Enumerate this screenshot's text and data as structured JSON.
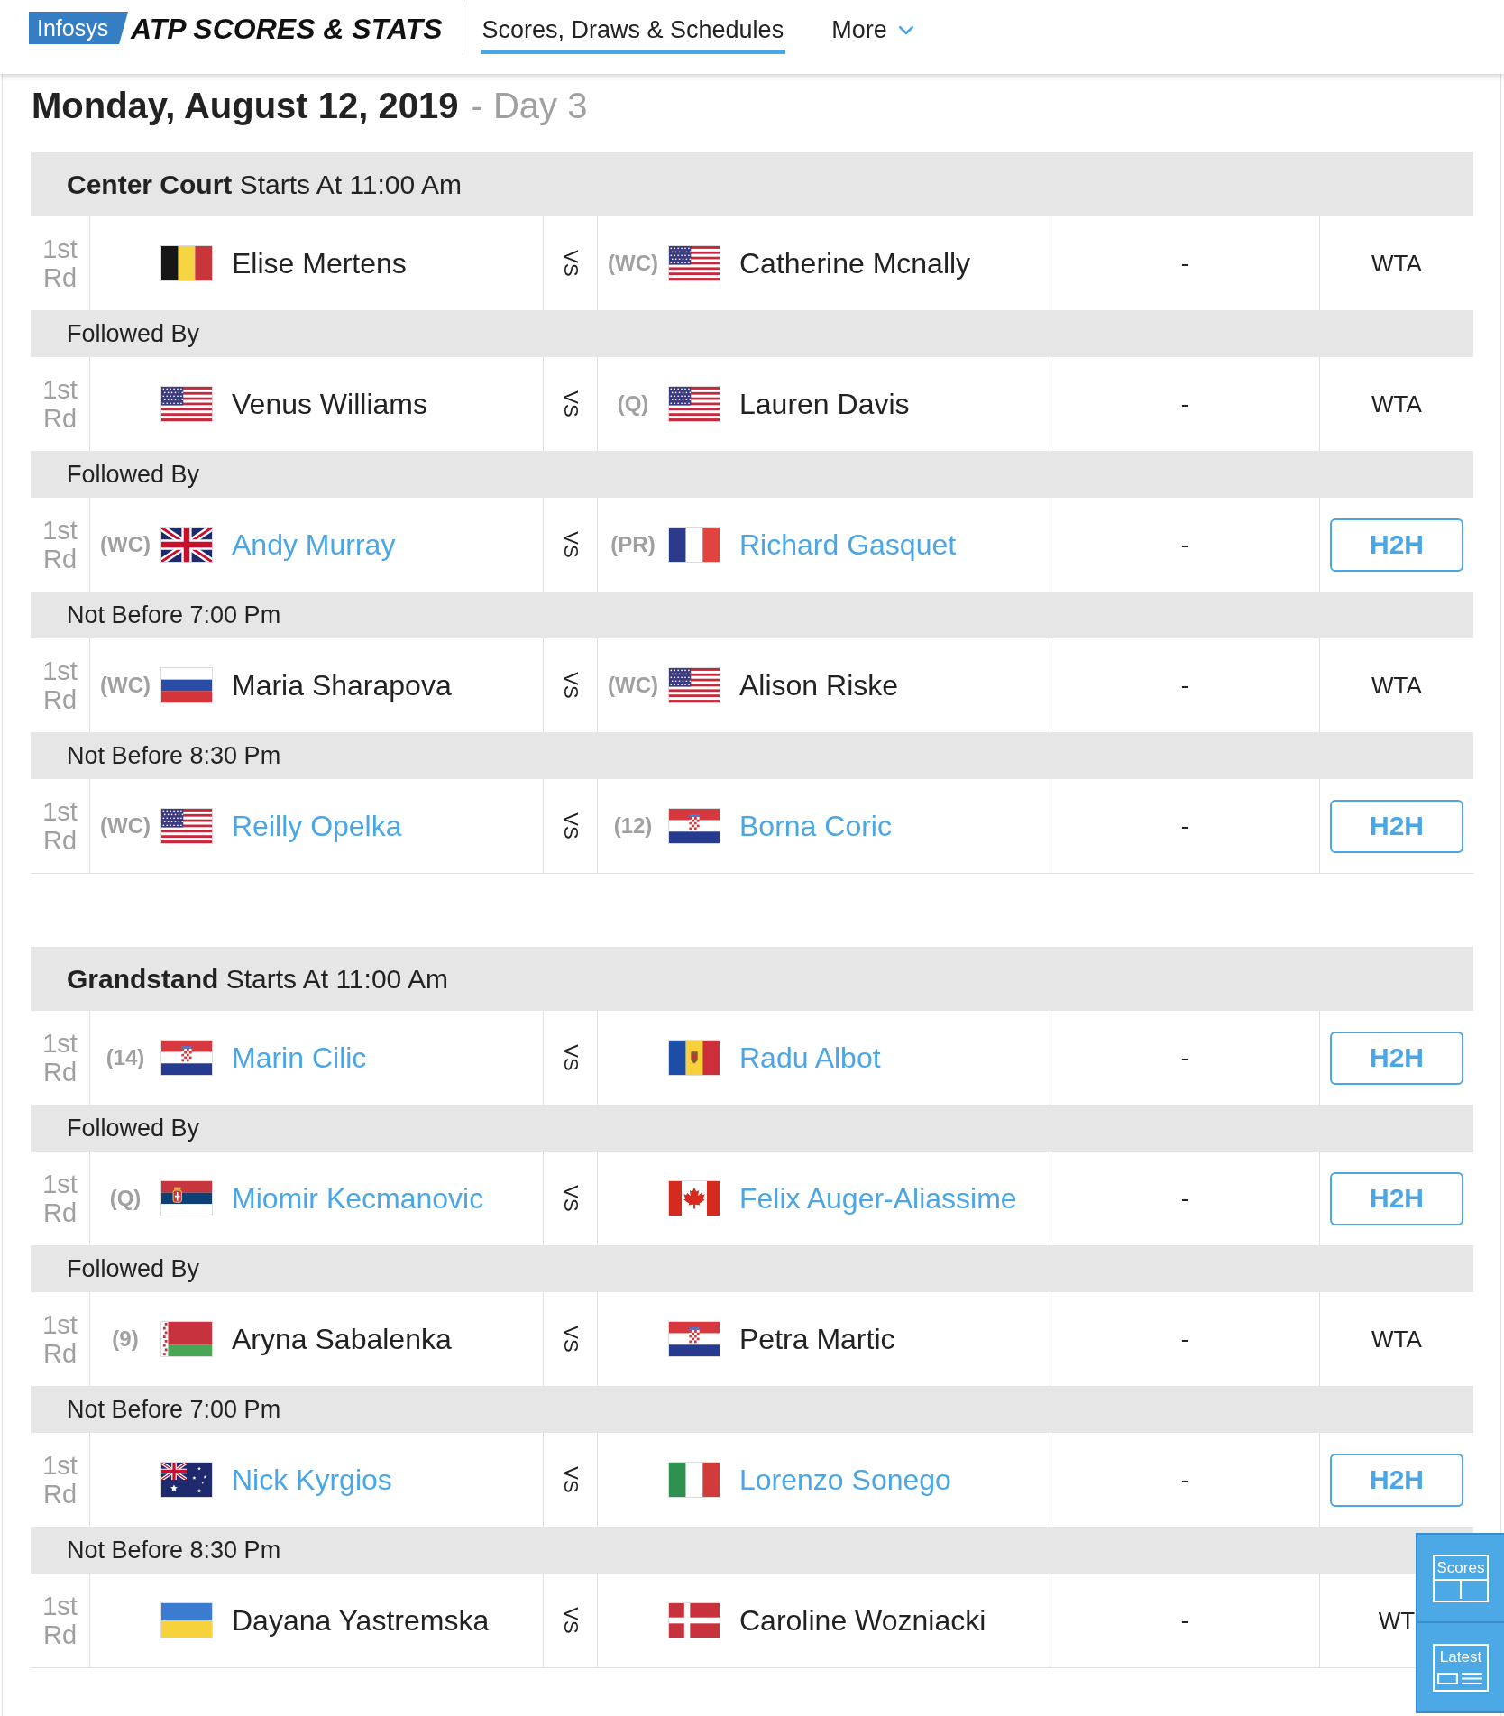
{
  "header": {
    "sponsor": "Infosys",
    "brand": "ATP SCORES & STATS",
    "tabs": [
      {
        "label": "Scores, Draws & Schedules",
        "selected": true,
        "menu": false
      },
      {
        "label": "More",
        "selected": false,
        "menu": true
      }
    ]
  },
  "date": "Monday, August 12, 2019",
  "day": "- Day 3",
  "courts": [
    {
      "title": "**Center Court** Starts At 11:00 Am",
      "rows": [
        {
          "kind": "match",
          "round": "1st Rd",
          "player1": {
            "flag": {
              "kind": "belgium"
            },
            "name": "Elise Mertens",
            "link": false
          },
          "vs": "VS",
          "player2": {
            "seed": "(WC)",
            "flag": {
              "kind": "usa"
            },
            "name": "Catherine Mcnally",
            "link": false
          },
          "score": "-",
          "action": {
            "kind": "tag",
            "label": "WTA"
          }
        },
        {
          "kind": "note",
          "text": "Followed By"
        },
        {
          "kind": "match",
          "round": "1st Rd",
          "player1": {
            "flag": {
              "kind": "usa"
            },
            "name": "Venus Williams",
            "link": false
          },
          "vs": "VS",
          "player2": {
            "seed": "(Q)",
            "flag": {
              "kind": "usa"
            },
            "name": "Lauren Davis",
            "link": false
          },
          "score": "-",
          "action": {
            "kind": "tag",
            "label": "WTA"
          }
        },
        {
          "kind": "note",
          "text": "Followed By"
        },
        {
          "kind": "match",
          "round": "1st Rd",
          "player1": {
            "seed": "(WC)",
            "flag": {
              "kind": "uk"
            },
            "name": "Andy Murray",
            "link": true
          },
          "vs": "VS",
          "player2": {
            "seed": "(PR)",
            "flag": {
              "kind": "france"
            },
            "name": "Richard Gasquet",
            "link": true
          },
          "score": "-",
          "action": {
            "kind": "button",
            "label": "H2H"
          }
        },
        {
          "kind": "note",
          "text": "Not Before 7:00 Pm"
        },
        {
          "kind": "match",
          "round": "1st Rd",
          "player1": {
            "seed": "(WC)",
            "flag": {
              "kind": "russia"
            },
            "name": "Maria Sharapova",
            "link": false
          },
          "vs": "VS",
          "player2": {
            "seed": "(WC)",
            "flag": {
              "kind": "usa"
            },
            "name": "Alison Riske",
            "link": false
          },
          "score": "-",
          "action": {
            "kind": "tag",
            "label": "WTA"
          }
        },
        {
          "kind": "note",
          "text": "Not Before 8:30 Pm"
        },
        {
          "kind": "match",
          "round": "1st Rd",
          "player1": {
            "seed": "(WC)",
            "flag": {
              "kind": "usa"
            },
            "name": "Reilly Opelka",
            "link": true
          },
          "vs": "VS",
          "player2": {
            "seed": "(12)",
            "flag": {
              "kind": "croatia"
            },
            "name": "Borna Coric",
            "link": true
          },
          "score": "-",
          "action": {
            "kind": "button",
            "label": "H2H"
          }
        }
      ]
    },
    {
      "title": "**Grandstand** Starts At 11:00 Am",
      "rows": [
        {
          "kind": "match",
          "round": "1st Rd",
          "player1": {
            "seed": "(14)",
            "flag": {
              "kind": "croatia"
            },
            "name": "Marin Cilic",
            "link": true
          },
          "vs": "VS",
          "player2": {
            "flag": {
              "kind": "moldova"
            },
            "name": "Radu Albot",
            "link": true
          },
          "score": "-",
          "action": {
            "kind": "button",
            "label": "H2H"
          }
        },
        {
          "kind": "note",
          "text": "Followed By"
        },
        {
          "kind": "match",
          "round": "1st Rd",
          "player1": {
            "seed": "(Q)",
            "flag": {
              "kind": "serbia"
            },
            "name": "Miomir Kecmanovic",
            "link": true
          },
          "vs": "VS",
          "player2": {
            "flag": {
              "kind": "canada"
            },
            "name": "Felix Auger-Aliassime",
            "link": true
          },
          "score": "-",
          "action": {
            "kind": "button",
            "label": "H2H"
          }
        },
        {
          "kind": "note",
          "text": "Followed By"
        },
        {
          "kind": "match",
          "round": "1st Rd",
          "player1": {
            "seed": "(9)",
            "flag": {
              "kind": "belarus"
            },
            "name": "Aryna Sabalenka",
            "link": false
          },
          "vs": "VS",
          "player2": {
            "flag": {
              "kind": "croatia"
            },
            "name": "Petra Martic",
            "link": false
          },
          "score": "-",
          "action": {
            "kind": "tag",
            "label": "WTA"
          }
        },
        {
          "kind": "note",
          "text": "Not Before 7:00 Pm"
        },
        {
          "kind": "match",
          "round": "1st Rd",
          "player1": {
            "flag": {
              "kind": "australia"
            },
            "name": "Nick Kyrgios",
            "link": true
          },
          "vs": "VS",
          "player2": {
            "flag": {
              "kind": "italy"
            },
            "name": "Lorenzo Sonego",
            "link": true
          },
          "score": "-",
          "action": {
            "kind": "button",
            "label": "H2H"
          }
        },
        {
          "kind": "note",
          "text": "Not Before 8:30 Pm"
        },
        {
          "kind": "match",
          "round": "1st Rd",
          "player1": {
            "flag": {
              "kind": "ukraine"
            },
            "name": "Dayana Yastremska",
            "link": false
          },
          "vs": "VS",
          "player2": {
            "flag": {
              "kind": "denmark"
            },
            "name": "Caroline Wozniacki",
            "link": false
          },
          "score": "-",
          "action": {
            "kind": "tag",
            "label": "WT"
          }
        }
      ]
    }
  ],
  "dock": [
    {
      "kind": "scores",
      "label": "Scores"
    },
    {
      "kind": "latest",
      "label": "Latest"
    }
  ]
}
